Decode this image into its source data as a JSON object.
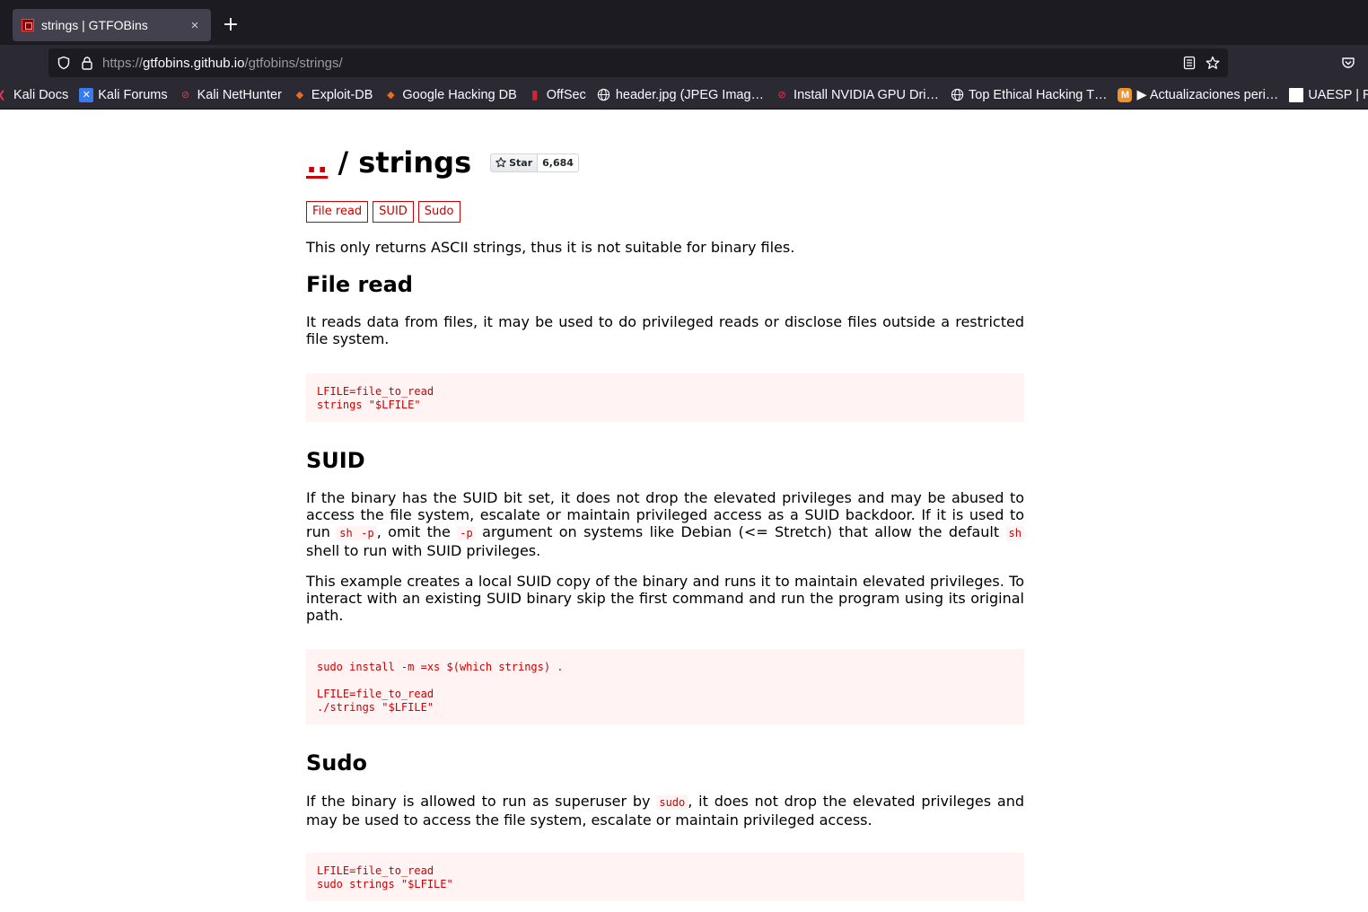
{
  "browser": {
    "tab_title": "strings | GTFOBins",
    "tab_close": "×",
    "new_tab": "+",
    "url_scheme": "https://",
    "url_host": "gtfobins.github.io",
    "url_path": "/gtfobins/strings/"
  },
  "bookmarks": [
    {
      "label": "Kali Docs",
      "icon": "kali-icon"
    },
    {
      "label": "Kali Forums",
      "icon": "kali-forums-icon"
    },
    {
      "label": "Kali NetHunter",
      "icon": "nethunter-icon"
    },
    {
      "label": "Exploit-DB",
      "icon": "exploitdb-icon"
    },
    {
      "label": "Google Hacking DB",
      "icon": "ghdb-icon"
    },
    {
      "label": "OffSec",
      "icon": "offsec-icon"
    },
    {
      "label": "header.jpg (JPEG Imag…",
      "icon": "globe-icon"
    },
    {
      "label": "Install NVIDIA GPU Dri…",
      "icon": "nethunter-icon"
    },
    {
      "label": "Top Ethical Hacking T…",
      "icon": "globe-icon"
    },
    {
      "label": "▶ Actualizaciones peri…",
      "icon": "m-icon"
    },
    {
      "label": "UAESP | RU",
      "icon": "uaesp-icon"
    }
  ],
  "page": {
    "up_link": "..",
    "title_sep": " / ",
    "title": "strings",
    "star_label": "Star",
    "star_count": "6,684",
    "tags": [
      "File read",
      "SUID",
      "Sudo"
    ],
    "intro": "This only returns ASCII strings, thus it is not suitable for binary files.",
    "file_read": {
      "heading": "File read",
      "desc": "It reads data from files, it may be used to do privileged reads or disclose files outside a restricted file system.",
      "code": "LFILE=file_to_read\nstrings \"$LFILE\""
    },
    "suid": {
      "heading": "SUID",
      "desc1_a": "If the binary has the SUID bit set, it does not drop the elevated privileges and may be abused to access the file system, escalate or maintain privileged access as a SUID backdoor. If it is used to run ",
      "desc1_code1": "sh -p",
      "desc1_b": ", omit the ",
      "desc1_code2": "-p",
      "desc1_c": " argument on systems like Debian (<= Stretch) that allow the default ",
      "desc1_code3": "sh",
      "desc1_d": " shell to run with SUID privileges.",
      "desc2": "This example creates a local SUID copy of the binary and runs it to maintain elevated privileges. To interact with an existing SUID binary skip the first command and run the program using its original path.",
      "code": "sudo install -m =xs $(which strings) .\n\nLFILE=file_to_read\n./strings \"$LFILE\""
    },
    "sudo": {
      "heading": "Sudo",
      "desc_a": "If the binary is allowed to run as superuser by ",
      "desc_code": "sudo",
      "desc_b": ", it does not drop the elevated privileges and may be used to access the file system, escalate or maintain privileged access.",
      "code": "LFILE=file_to_read\nsudo strings \"$LFILE\""
    }
  },
  "colors": {
    "accent_red": "#cc0000",
    "code_bg": "#fff3f3",
    "chrome_dark": "#1c1b22",
    "chrome_bar": "#2b2a33"
  }
}
